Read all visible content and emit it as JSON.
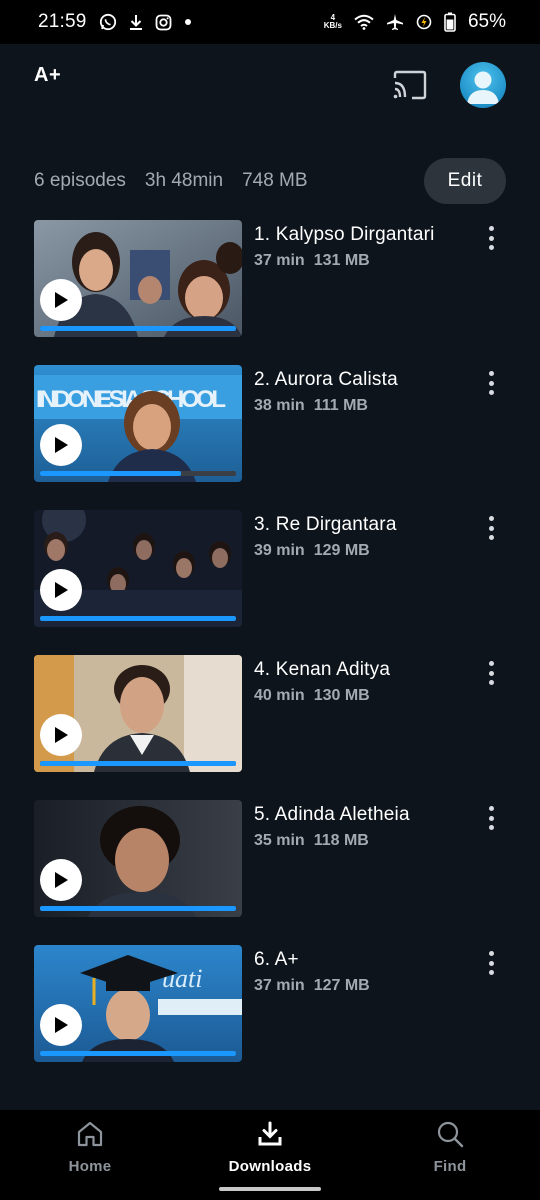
{
  "status_bar": {
    "time": "21:59",
    "net_speed_value": "4",
    "net_speed_unit": "KB/s",
    "battery_percent": "65%",
    "icons": [
      "whatsapp-icon",
      "download-icon",
      "instagram-icon",
      "dot-icon",
      "wifi-icon",
      "airplane-icon",
      "power-saver-icon",
      "battery-icon"
    ]
  },
  "header": {
    "brand": "A+",
    "icons": [
      "cast-icon",
      "avatar"
    ]
  },
  "summary": {
    "episodes": "6 episodes",
    "duration": "3h 48min",
    "size": "748 MB",
    "edit_label": "Edit"
  },
  "episodes": [
    {
      "title": "1. Kalypso Dirgantari",
      "duration": "37 min",
      "size": "131 MB",
      "progress": 1.0
    },
    {
      "title": "2. Aurora Calista",
      "duration": "38 min",
      "size": "111 MB",
      "progress": 0.72
    },
    {
      "title": "3. Re Dirgantara",
      "duration": "39 min",
      "size": "129 MB",
      "progress": 1.0
    },
    {
      "title": "4. Kenan Aditya",
      "duration": "40 min",
      "size": "130 MB",
      "progress": 1.0
    },
    {
      "title": "5. Adinda Aletheia",
      "duration": "35 min",
      "size": "118 MB",
      "progress": 1.0
    },
    {
      "title": "6. A+",
      "duration": "37 min",
      "size": "127 MB",
      "progress": 1.0
    }
  ],
  "bottom_nav": [
    {
      "label": "Home",
      "icon": "home-icon",
      "active": false
    },
    {
      "label": "Downloads",
      "icon": "download-icon",
      "active": true
    },
    {
      "label": "Find",
      "icon": "search-icon",
      "active": false
    }
  ],
  "colors": {
    "background": "#0e141c",
    "accent": "#1a98ff",
    "secondary_text": "#a3aab2"
  }
}
